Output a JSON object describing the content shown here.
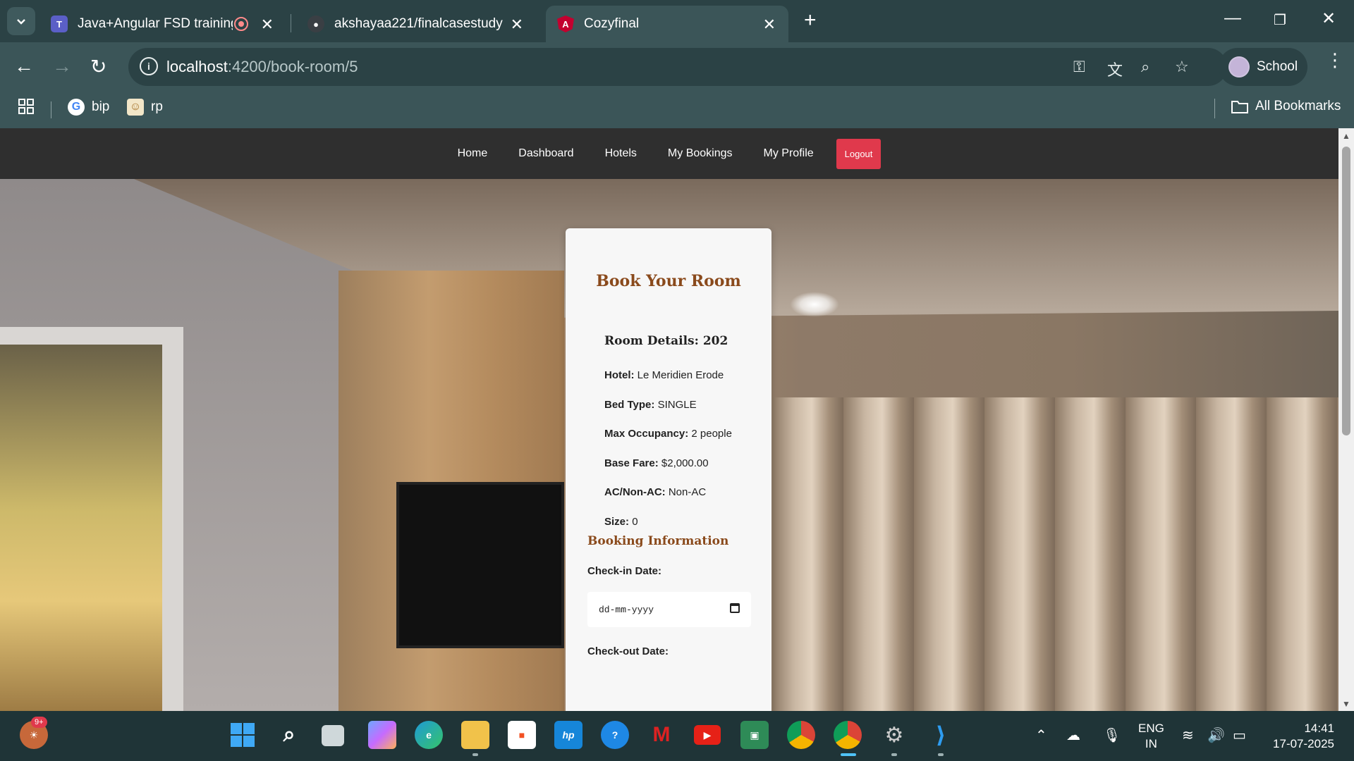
{
  "browser": {
    "tabs": [
      {
        "label": "Java+Angular FSD training",
        "icon": "teams-icon"
      },
      {
        "label": "akshayaa221/finalcasestudy",
        "icon": "github-icon"
      },
      {
        "label": "Cozyfinal",
        "icon": "angular-icon"
      }
    ],
    "url_host": "localhost",
    "url_path": ":4200/book-room/5",
    "profile_label": "School",
    "bookmarks": [
      {
        "label": "bip",
        "icon": "google-icon"
      },
      {
        "label": "rp",
        "icon": "image-icon"
      }
    ],
    "all_bookmarks_label": "All Bookmarks"
  },
  "nav": {
    "items": [
      "Home",
      "Dashboard",
      "Hotels",
      "My Bookings",
      "My Profile"
    ],
    "logout": "Logout"
  },
  "booking": {
    "title": "Book Your Room",
    "room_heading": "Room Details: 202",
    "details": [
      {
        "label": "Hotel:",
        "value": "Le Meridien Erode"
      },
      {
        "label": "Bed Type:",
        "value": "SINGLE"
      },
      {
        "label": "Max Occupancy:",
        "value": "2 people"
      },
      {
        "label": "Base Fare:",
        "value": "$2,000.00"
      },
      {
        "label": "AC/Non-AC:",
        "value": "Non-AC"
      },
      {
        "label": "Size:",
        "value": "0"
      }
    ],
    "booking_info_heading": "Booking Information",
    "checkin_label": "Check-in Date:",
    "checkin_placeholder": "dd-mm-yyyy",
    "checkout_label": "Check-out Date:"
  },
  "taskbar": {
    "notification_badge": "9+",
    "language": "ENG",
    "region": "IN",
    "time": "14:41",
    "date": "17-07-2025"
  }
}
